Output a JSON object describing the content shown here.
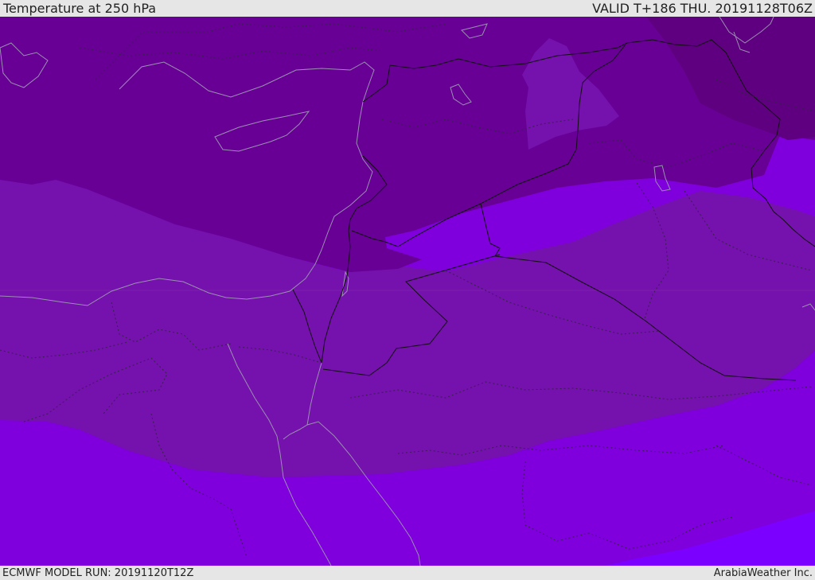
{
  "header": {
    "title": "Temperature at 250 hPa",
    "valid_time": "VALID T+186 THU. 20191128T06Z"
  },
  "footer": {
    "model_run": "ECMWF MODEL RUN: 20191120T12Z",
    "provider": "ArabiaWeather Inc."
  },
  "map": {
    "variable": "temperature",
    "level": "250 hPa",
    "band_colors": [
      "#5e007f",
      "#680096",
      "#7511ac",
      "#7f00dd",
      "#7c00ff"
    ],
    "border_color": "#111111",
    "coastline_color": "#9a8fb0",
    "internal_border_color": "#3a1f4f"
  }
}
